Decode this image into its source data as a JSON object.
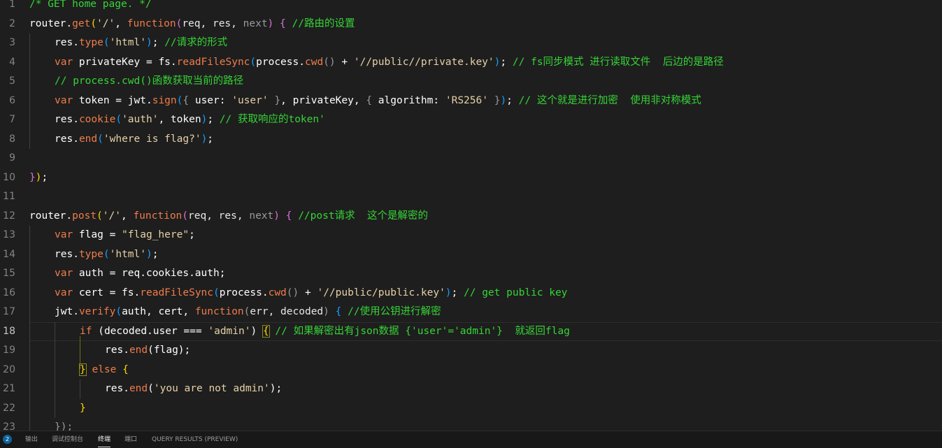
{
  "editor": {
    "language": "javascript",
    "active_line": 18,
    "lines": [
      {
        "n": "1",
        "tokens": [
          {
            "t": "/* GET home page. */",
            "c": "comment"
          }
        ]
      },
      {
        "n": "2",
        "tokens": [
          {
            "t": "router",
            "c": "var"
          },
          {
            "t": ".",
            "c": "punct"
          },
          {
            "t": "get",
            "c": "method"
          },
          {
            "t": "(",
            "c": "brace1"
          },
          {
            "t": "'/'",
            "c": "string"
          },
          {
            "t": ", ",
            "c": "punct"
          },
          {
            "t": "function",
            "c": "keyword"
          },
          {
            "t": "(",
            "c": "brace2"
          },
          {
            "t": "req, res, ",
            "c": "param"
          },
          {
            "t": "next",
            "c": "dim"
          },
          {
            "t": ")",
            "c": "brace2"
          },
          {
            "t": " ",
            "c": "punct"
          },
          {
            "t": "{",
            "c": "brace2"
          },
          {
            "t": " //路由的设置",
            "c": "comment"
          }
        ]
      },
      {
        "n": "3",
        "indent": 1,
        "tokens": [
          {
            "t": "res",
            "c": "var"
          },
          {
            "t": ".",
            "c": "punct"
          },
          {
            "t": "type",
            "c": "method"
          },
          {
            "t": "(",
            "c": "brace3"
          },
          {
            "t": "'html'",
            "c": "string"
          },
          {
            "t": ")",
            "c": "brace3"
          },
          {
            "t": "; ",
            "c": "punct"
          },
          {
            "t": "//请求的形式",
            "c": "comment"
          }
        ]
      },
      {
        "n": "4",
        "indent": 1,
        "tokens": [
          {
            "t": "var ",
            "c": "keyword"
          },
          {
            "t": "privateKey",
            "c": "var"
          },
          {
            "t": " = ",
            "c": "punct"
          },
          {
            "t": "fs",
            "c": "var"
          },
          {
            "t": ".",
            "c": "punct"
          },
          {
            "t": "readFileSync",
            "c": "method"
          },
          {
            "t": "(",
            "c": "brace3"
          },
          {
            "t": "process",
            "c": "var"
          },
          {
            "t": ".",
            "c": "punct"
          },
          {
            "t": "cwd",
            "c": "method"
          },
          {
            "t": "()",
            "c": "dim"
          },
          {
            "t": " + ",
            "c": "punct"
          },
          {
            "t": "'//public//private.key'",
            "c": "string"
          },
          {
            "t": ")",
            "c": "brace3"
          },
          {
            "t": "; ",
            "c": "punct"
          },
          {
            "t": "// fs同步模式 进行读取文件  后边的是路径",
            "c": "comment"
          }
        ]
      },
      {
        "n": "5",
        "indent": 1,
        "tokens": [
          {
            "t": "// process.cwd()函数获取当前的路径",
            "c": "comment"
          }
        ]
      },
      {
        "n": "6",
        "indent": 1,
        "tokens": [
          {
            "t": "var ",
            "c": "keyword"
          },
          {
            "t": "token",
            "c": "var"
          },
          {
            "t": " = ",
            "c": "punct"
          },
          {
            "t": "jwt",
            "c": "var"
          },
          {
            "t": ".",
            "c": "punct"
          },
          {
            "t": "sign",
            "c": "method"
          },
          {
            "t": "(",
            "c": "brace3"
          },
          {
            "t": "{",
            "c": "dim"
          },
          {
            "t": " user",
            "c": "prop"
          },
          {
            "t": ": ",
            "c": "punct"
          },
          {
            "t": "'user'",
            "c": "string"
          },
          {
            "t": " ",
            "c": "punct"
          },
          {
            "t": "}",
            "c": "dim"
          },
          {
            "t": ", ",
            "c": "punct"
          },
          {
            "t": "privateKey",
            "c": "var"
          },
          {
            "t": ", ",
            "c": "punct"
          },
          {
            "t": "{",
            "c": "dim"
          },
          {
            "t": " algorithm",
            "c": "prop"
          },
          {
            "t": ": ",
            "c": "punct"
          },
          {
            "t": "'RS256'",
            "c": "string"
          },
          {
            "t": " ",
            "c": "punct"
          },
          {
            "t": "}",
            "c": "dim"
          },
          {
            "t": ")",
            "c": "brace3"
          },
          {
            "t": "; ",
            "c": "punct"
          },
          {
            "t": "// 这个就是进行加密  使用非对称模式",
            "c": "comment"
          }
        ]
      },
      {
        "n": "7",
        "indent": 1,
        "tokens": [
          {
            "t": "res",
            "c": "var"
          },
          {
            "t": ".",
            "c": "punct"
          },
          {
            "t": "cookie",
            "c": "method"
          },
          {
            "t": "(",
            "c": "brace3"
          },
          {
            "t": "'auth'",
            "c": "string"
          },
          {
            "t": ", ",
            "c": "punct"
          },
          {
            "t": "token",
            "c": "var"
          },
          {
            "t": ")",
            "c": "brace3"
          },
          {
            "t": "; ",
            "c": "punct"
          },
          {
            "t": "// 获取响应的token'",
            "c": "comment"
          }
        ]
      },
      {
        "n": "8",
        "indent": 1,
        "tokens": [
          {
            "t": "res",
            "c": "var"
          },
          {
            "t": ".",
            "c": "punct"
          },
          {
            "t": "end",
            "c": "method"
          },
          {
            "t": "(",
            "c": "brace3"
          },
          {
            "t": "'where is flag?'",
            "c": "string"
          },
          {
            "t": ")",
            "c": "brace3"
          },
          {
            "t": ";",
            "c": "punct"
          }
        ]
      },
      {
        "n": "9",
        "tokens": []
      },
      {
        "n": "10",
        "tokens": [
          {
            "t": "}",
            "c": "brace2"
          },
          {
            "t": ")",
            "c": "brace1"
          },
          {
            "t": ";",
            "c": "punct"
          }
        ]
      },
      {
        "n": "11",
        "tokens": []
      },
      {
        "n": "12",
        "tokens": [
          {
            "t": "router",
            "c": "var"
          },
          {
            "t": ".",
            "c": "punct"
          },
          {
            "t": "post",
            "c": "method"
          },
          {
            "t": "(",
            "c": "brace1"
          },
          {
            "t": "'/'",
            "c": "string"
          },
          {
            "t": ", ",
            "c": "punct"
          },
          {
            "t": "function",
            "c": "keyword"
          },
          {
            "t": "(",
            "c": "brace2"
          },
          {
            "t": "req, res, ",
            "c": "param"
          },
          {
            "t": "next",
            "c": "dim"
          },
          {
            "t": ")",
            "c": "brace2"
          },
          {
            "t": " ",
            "c": "punct"
          },
          {
            "t": "{",
            "c": "brace2"
          },
          {
            "t": " //post请求  这个是解密的",
            "c": "comment"
          }
        ]
      },
      {
        "n": "13",
        "indent": 1,
        "tokens": [
          {
            "t": "var ",
            "c": "keyword"
          },
          {
            "t": "flag",
            "c": "var"
          },
          {
            "t": " = ",
            "c": "punct"
          },
          {
            "t": "\"flag_here\"",
            "c": "string"
          },
          {
            "t": ";",
            "c": "punct"
          }
        ]
      },
      {
        "n": "14",
        "indent": 1,
        "tokens": [
          {
            "t": "res",
            "c": "var"
          },
          {
            "t": ".",
            "c": "punct"
          },
          {
            "t": "type",
            "c": "method"
          },
          {
            "t": "(",
            "c": "brace3"
          },
          {
            "t": "'html'",
            "c": "string"
          },
          {
            "t": ")",
            "c": "brace3"
          },
          {
            "t": ";",
            "c": "punct"
          }
        ]
      },
      {
        "n": "15",
        "indent": 1,
        "tokens": [
          {
            "t": "var ",
            "c": "keyword"
          },
          {
            "t": "auth",
            "c": "var"
          },
          {
            "t": " = ",
            "c": "punct"
          },
          {
            "t": "req.cookies.auth",
            "c": "var"
          },
          {
            "t": ";",
            "c": "punct"
          }
        ]
      },
      {
        "n": "16",
        "indent": 1,
        "tokens": [
          {
            "t": "var ",
            "c": "keyword"
          },
          {
            "t": "cert",
            "c": "var"
          },
          {
            "t": " = ",
            "c": "punct"
          },
          {
            "t": "fs",
            "c": "var"
          },
          {
            "t": ".",
            "c": "punct"
          },
          {
            "t": "readFileSync",
            "c": "method"
          },
          {
            "t": "(",
            "c": "brace3"
          },
          {
            "t": "process",
            "c": "var"
          },
          {
            "t": ".",
            "c": "punct"
          },
          {
            "t": "cwd",
            "c": "method"
          },
          {
            "t": "()",
            "c": "dim"
          },
          {
            "t": " + ",
            "c": "punct"
          },
          {
            "t": "'//public/public.key'",
            "c": "string"
          },
          {
            "t": ")",
            "c": "brace3"
          },
          {
            "t": "; ",
            "c": "punct"
          },
          {
            "t": "// get public key",
            "c": "comment"
          }
        ]
      },
      {
        "n": "17",
        "indent": 1,
        "tokens": [
          {
            "t": "jwt",
            "c": "var"
          },
          {
            "t": ".",
            "c": "punct"
          },
          {
            "t": "verify",
            "c": "method"
          },
          {
            "t": "(",
            "c": "brace3"
          },
          {
            "t": "auth, cert, ",
            "c": "var"
          },
          {
            "t": "function",
            "c": "keyword"
          },
          {
            "t": "(",
            "c": "dim"
          },
          {
            "t": "err, decoded",
            "c": "param"
          },
          {
            "t": ")",
            "c": "dim"
          },
          {
            "t": " ",
            "c": "punct"
          },
          {
            "t": "{",
            "c": "brace3"
          },
          {
            "t": " //使用公钥进行解密",
            "c": "comment"
          }
        ]
      },
      {
        "n": "18",
        "indent": 2,
        "tokens": [
          {
            "t": "if ",
            "c": "keyword"
          },
          {
            "t": "(",
            "c": "punct"
          },
          {
            "t": "decoded.user",
            "c": "var"
          },
          {
            "t": " === ",
            "c": "punct"
          },
          {
            "t": "'admin'",
            "c": "string"
          },
          {
            "t": ") ",
            "c": "punct"
          },
          {
            "t": "{",
            "c": "brace1",
            "box": true
          },
          {
            "t": " // 如果解密出有json数据 {'user'='admin'}  就返回flag",
            "c": "comment"
          }
        ]
      },
      {
        "n": "19",
        "indent": 3,
        "tokens": [
          {
            "t": "res",
            "c": "var"
          },
          {
            "t": ".",
            "c": "punct"
          },
          {
            "t": "end",
            "c": "method"
          },
          {
            "t": "(",
            "c": "punct"
          },
          {
            "t": "flag",
            "c": "var"
          },
          {
            "t": ")",
            "c": "punct"
          },
          {
            "t": ";",
            "c": "punct"
          }
        ]
      },
      {
        "n": "20",
        "indent": 2,
        "tokens": [
          {
            "t": "}",
            "c": "brace1",
            "box": true
          },
          {
            "t": " else ",
            "c": "keyword"
          },
          {
            "t": "{",
            "c": "brace1"
          }
        ]
      },
      {
        "n": "21",
        "indent": 3,
        "tokens": [
          {
            "t": "res",
            "c": "var"
          },
          {
            "t": ".",
            "c": "punct"
          },
          {
            "t": "end",
            "c": "method"
          },
          {
            "t": "(",
            "c": "punct"
          },
          {
            "t": "'you are not admin'",
            "c": "string"
          },
          {
            "t": ")",
            "c": "punct"
          },
          {
            "t": ";",
            "c": "punct"
          }
        ]
      },
      {
        "n": "22",
        "indent": 2,
        "tokens": [
          {
            "t": "}",
            "c": "brace1"
          }
        ]
      },
      {
        "n": "23",
        "indent": 1,
        "tokens": [
          {
            "t": "});",
            "c": "dim"
          }
        ]
      }
    ]
  },
  "panel": {
    "badge_count": "2",
    "tabs": [
      {
        "label": "输出",
        "active": false
      },
      {
        "label": "调试控制台",
        "active": false
      },
      {
        "label": "终端",
        "active": true
      },
      {
        "label": "端口",
        "active": false
      },
      {
        "label": "QUERY RESULTS (PREVIEW)",
        "active": false
      }
    ]
  }
}
